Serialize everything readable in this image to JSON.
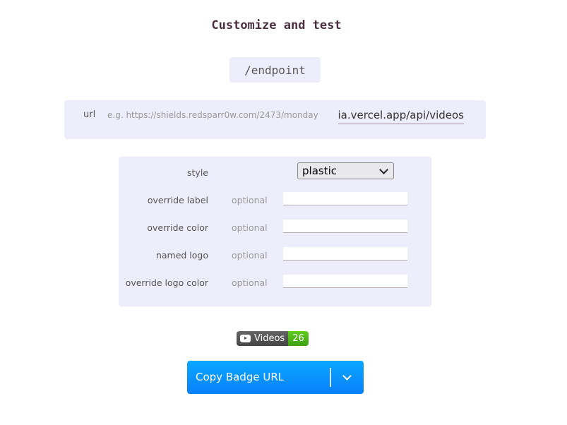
{
  "header": {
    "title": "Customize and test"
  },
  "endpoint": {
    "path": "/endpoint"
  },
  "url_field": {
    "label": "url",
    "placeholder": "e.g. https://shields.redsparr0w.com/2473/monday",
    "value": "ia.vercel.app/api/videos"
  },
  "params": {
    "style": {
      "label": "style",
      "selected": "plastic"
    },
    "override_label": {
      "label": "override label",
      "optional": "optional",
      "value": ""
    },
    "override_color": {
      "label": "override color",
      "optional": "optional",
      "value": ""
    },
    "named_logo": {
      "label": "named logo",
      "optional": "optional",
      "value": ""
    },
    "override_logo_color": {
      "label": "override logo color",
      "optional": "optional",
      "value": ""
    }
  },
  "badge": {
    "icon": "youtube-icon",
    "label": "Videos",
    "message": "26",
    "label_color": "#555555",
    "message_color": "#4c1"
  },
  "copy_button": {
    "label": "Copy Badge URL",
    "icon": "chevron-down-icon",
    "color": "#0a8efd"
  }
}
